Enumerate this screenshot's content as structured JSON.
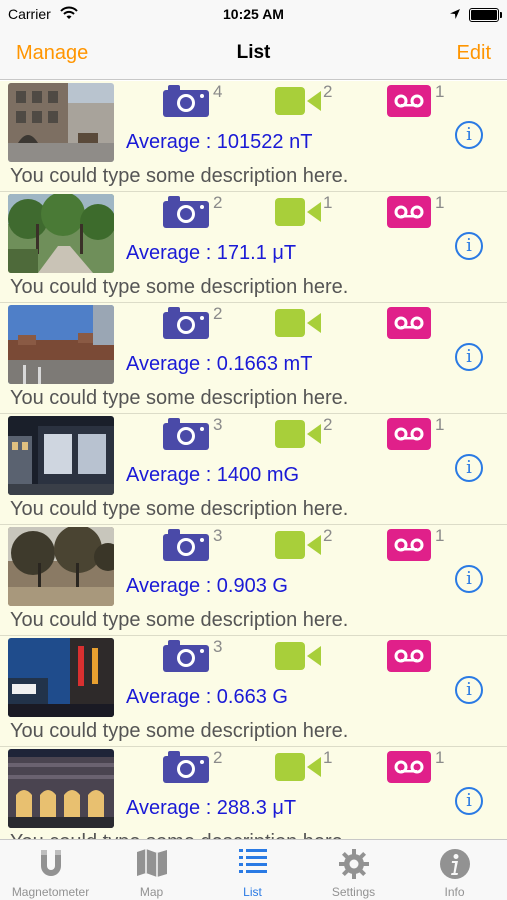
{
  "status_bar": {
    "carrier": "Carrier",
    "time": "10:25 AM"
  },
  "nav": {
    "left_button": "Manage",
    "title": "List",
    "right_button": "Edit"
  },
  "colors": {
    "accent_orange": "#ff9500",
    "camera": "#4a4aa8",
    "video": "#a8cf3a",
    "audio": "#e0208a",
    "average_text": "#1a1ad6",
    "info": "#2a7ae4",
    "list_bg": "#fcfce6"
  },
  "items": [
    {
      "photos": "4",
      "videos": "2",
      "audio": "1",
      "average": "Average : 101522 nT",
      "description": "You could type some description here."
    },
    {
      "photos": "2",
      "videos": "1",
      "audio": "1",
      "average": "Average : 171.1 μT",
      "description": "You could type some description here."
    },
    {
      "photos": "2",
      "videos": "",
      "audio": "",
      "average": "Average : 0.1663 mT",
      "description": "You could type some description here."
    },
    {
      "photos": "3",
      "videos": "2",
      "audio": "1",
      "average": "Average : 1400 mG",
      "description": "You could type some description here."
    },
    {
      "photos": "3",
      "videos": "2",
      "audio": "1",
      "average": "Average : 0.903 G",
      "description": "You could type some description here."
    },
    {
      "photos": "3",
      "videos": "",
      "audio": "",
      "average": "Average : 0.663 G",
      "description": "You could type some description here."
    },
    {
      "photos": "2",
      "videos": "1",
      "audio": "1",
      "average": "Average : 288.3 μT",
      "description": "You could type some description here."
    }
  ],
  "info_glyph": "i",
  "tabs": [
    {
      "label": "Magnetometer",
      "icon": "magnet-icon"
    },
    {
      "label": "Map",
      "icon": "map-icon"
    },
    {
      "label": "List",
      "icon": "list-icon"
    },
    {
      "label": "Settings",
      "icon": "gear-icon"
    },
    {
      "label": "Info",
      "icon": "info-icon"
    }
  ]
}
